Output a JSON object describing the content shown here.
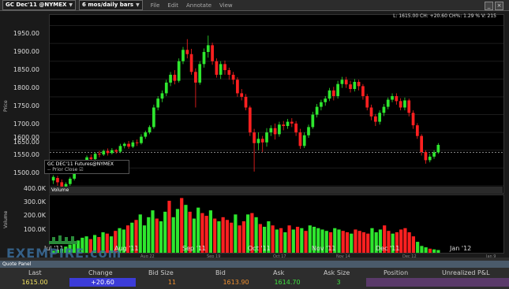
{
  "toolbar": {
    "symbol": "GC Dec'11 @NYMEX",
    "timeframe": "6 mos/daily bars",
    "menus": [
      "File",
      "Edit",
      "Annotate",
      "View"
    ]
  },
  "info_line": "L: 1615.00 CH: +20.60 CH%: 1.29 % V: 215",
  "price_chart": {
    "ylabel": "Price",
    "y_ticks": [
      "1950.00",
      "1900.00",
      "1850.00",
      "1800.00",
      "1750.00",
      "1700.00",
      "1650.00",
      "1600.00",
      "1550.00",
      "1500.00"
    ],
    "contract_label": "GC DEC'11 Futures@NYMEX",
    "prior_close_label": "Prior Close",
    "prior_close_value": 1594.4
  },
  "volume_chart": {
    "header": "Volume",
    "ylabel": "Volume",
    "y_ticks": [
      "400.0K",
      "300.0K",
      "200.0K",
      "100.0K"
    ]
  },
  "x_axis": {
    "months": [
      "Jul '11",
      "Aug '11",
      "Sep '11",
      "Oct '11",
      "Nov '11",
      "Dec '11",
      "Jan '12"
    ],
    "small_dates": [
      "Aug 22",
      "Sep 19",
      "Oct 17",
      "Nov 14",
      "Dec 12",
      "Jan 9"
    ]
  },
  "watermark": "EXEMPIRE.com",
  "quote_panel": {
    "title": "Quote Panel",
    "headers": [
      "Last",
      "Change",
      "Bid Size",
      "Bid",
      "Ask",
      "Ask Size",
      "Position",
      "Unrealized P&L"
    ],
    "values": [
      "1615.00",
      "+20.60",
      "11",
      "1613.90",
      "1614.70",
      "3",
      "",
      ""
    ]
  },
  "colors": {
    "up": "#2ee62e",
    "down": "#ff2020",
    "change_bg": "#3c3cd8",
    "panel_bg": "#2d2d2d"
  },
  "chart_data": [
    {
      "type": "candlestick",
      "ylabel": "Price",
      "ylim": [
        1480,
        1980
      ],
      "points": [
        [
          1515,
          1525,
          1505,
          1530
        ],
        [
          1522,
          1510,
          1500,
          1528
        ],
        [
          1510,
          1498,
          1490,
          1518
        ],
        [
          1498,
          1505,
          1488,
          1510
        ],
        [
          1505,
          1520,
          1500,
          1525
        ],
        [
          1520,
          1540,
          1515,
          1545
        ],
        [
          1540,
          1550,
          1535,
          1555
        ],
        [
          1550,
          1568,
          1545,
          1572
        ],
        [
          1568,
          1580,
          1560,
          1585
        ],
        [
          1580,
          1575,
          1565,
          1588
        ],
        [
          1575,
          1590,
          1570,
          1595
        ],
        [
          1590,
          1588,
          1580,
          1598
        ],
        [
          1588,
          1598,
          1584,
          1602
        ],
        [
          1598,
          1592,
          1585,
          1605
        ],
        [
          1592,
          1600,
          1588,
          1606
        ],
        [
          1600,
          1596,
          1590,
          1604
        ],
        [
          1596,
          1612,
          1592,
          1618
        ],
        [
          1612,
          1618,
          1605,
          1622
        ],
        [
          1618,
          1610,
          1604,
          1626
        ],
        [
          1610,
          1622,
          1606,
          1628
        ],
        [
          1622,
          1620,
          1612,
          1630
        ],
        [
          1620,
          1638,
          1616,
          1645
        ],
        [
          1638,
          1650,
          1632,
          1655
        ],
        [
          1650,
          1665,
          1645,
          1670
        ],
        [
          1665,
          1720,
          1660,
          1728
        ],
        [
          1720,
          1745,
          1712,
          1752
        ],
        [
          1745,
          1760,
          1735,
          1768
        ],
        [
          1760,
          1790,
          1752,
          1798
        ],
        [
          1790,
          1812,
          1780,
          1820
        ],
        [
          1812,
          1795,
          1785,
          1825
        ],
        [
          1795,
          1850,
          1790,
          1858
        ],
        [
          1850,
          1882,
          1842,
          1890
        ],
        [
          1882,
          1870,
          1858,
          1912
        ],
        [
          1870,
          1820,
          1812,
          1885
        ],
        [
          1820,
          1790,
          1720,
          1830
        ],
        [
          1790,
          1842,
          1784,
          1850
        ],
        [
          1842,
          1876,
          1832,
          1886
        ],
        [
          1876,
          1895,
          1860,
          1922
        ],
        [
          1895,
          1850,
          1840,
          1902
        ],
        [
          1850,
          1812,
          1804,
          1858
        ],
        [
          1812,
          1842,
          1800,
          1850
        ],
        [
          1842,
          1825,
          1812,
          1852
        ],
        [
          1825,
          1812,
          1798,
          1832
        ],
        [
          1812,
          1798,
          1785,
          1820
        ],
        [
          1798,
          1760,
          1750,
          1805
        ],
        [
          1760,
          1750,
          1740,
          1772
        ],
        [
          1750,
          1720,
          1712,
          1758
        ],
        [
          1720,
          1650,
          1640,
          1725
        ],
        [
          1650,
          1620,
          1540,
          1660
        ],
        [
          1620,
          1632,
          1600,
          1650
        ],
        [
          1632,
          1622,
          1595,
          1640
        ],
        [
          1622,
          1650,
          1610,
          1662
        ],
        [
          1650,
          1662,
          1640,
          1670
        ],
        [
          1662,
          1645,
          1630,
          1675
        ],
        [
          1645,
          1672,
          1638,
          1680
        ],
        [
          1672,
          1668,
          1656,
          1682
        ],
        [
          1668,
          1680,
          1660,
          1688
        ],
        [
          1680,
          1675,
          1665,
          1690
        ],
        [
          1675,
          1650,
          1640,
          1682
        ],
        [
          1650,
          1612,
          1604,
          1660
        ],
        [
          1612,
          1642,
          1606,
          1650
        ],
        [
          1642,
          1665,
          1635,
          1672
        ],
        [
          1665,
          1700,
          1660,
          1708
        ],
        [
          1700,
          1722,
          1692,
          1730
        ],
        [
          1722,
          1735,
          1712,
          1742
        ],
        [
          1735,
          1745,
          1725,
          1752
        ],
        [
          1745,
          1768,
          1738,
          1775
        ],
        [
          1768,
          1752,
          1740,
          1778
        ],
        [
          1752,
          1786,
          1745,
          1795
        ],
        [
          1786,
          1798,
          1775,
          1806
        ],
        [
          1798,
          1785,
          1775,
          1806
        ],
        [
          1785,
          1772,
          1762,
          1795
        ],
        [
          1772,
          1792,
          1765,
          1800
        ],
        [
          1792,
          1780,
          1768,
          1798
        ],
        [
          1780,
          1752,
          1742,
          1786
        ],
        [
          1752,
          1720,
          1712,
          1758
        ],
        [
          1720,
          1695,
          1684,
          1728
        ],
        [
          1695,
          1680,
          1668,
          1702
        ],
        [
          1680,
          1705,
          1672,
          1712
        ],
        [
          1705,
          1722,
          1696,
          1730
        ],
        [
          1722,
          1742,
          1715,
          1748
        ],
        [
          1742,
          1752,
          1735,
          1760
        ],
        [
          1752,
          1738,
          1728,
          1760
        ],
        [
          1738,
          1720,
          1712,
          1746
        ],
        [
          1720,
          1740,
          1712,
          1748
        ],
        [
          1740,
          1705,
          1695,
          1745
        ],
        [
          1705,
          1670,
          1660,
          1712
        ],
        [
          1670,
          1640,
          1632,
          1676
        ],
        [
          1640,
          1595,
          1585,
          1645
        ],
        [
          1595,
          1572,
          1562,
          1600
        ],
        [
          1572,
          1582,
          1566,
          1590
        ],
        [
          1582,
          1594,
          1576,
          1600
        ],
        [
          1594,
          1615,
          1590,
          1620
        ]
      ]
    },
    {
      "type": "bar",
      "ylabel": "Volume",
      "ylim": [
        0,
        420000
      ],
      "values": [
        15000,
        20000,
        30000,
        45000,
        60000,
        80000,
        90000,
        110000,
        120000,
        100000,
        130000,
        115000,
        150000,
        140000,
        120000,
        160000,
        180000,
        170000,
        200000,
        220000,
        240000,
        280000,
        200000,
        260000,
        310000,
        250000,
        230000,
        300000,
        380000,
        260000,
        320000,
        400000,
        350000,
        300000,
        250000,
        330000,
        290000,
        270000,
        310000,
        250000,
        230000,
        260000,
        240000,
        220000,
        280000,
        200000,
        230000,
        280000,
        290000,
        260000,
        210000,
        190000,
        230000,
        200000,
        170000,
        180000,
        150000,
        200000,
        170000,
        190000,
        180000,
        160000,
        200000,
        190000,
        180000,
        170000,
        160000,
        150000,
        180000,
        170000,
        160000,
        150000,
        140000,
        170000,
        160000,
        150000,
        140000,
        180000,
        150000,
        170000,
        200000,
        160000,
        140000,
        150000,
        170000,
        180000,
        150000,
        120000,
        80000,
        50000,
        40000,
        30000,
        25000,
        20000
      ],
      "colors": [
        "up",
        "up",
        "up",
        "up",
        "up",
        "up",
        "up",
        "up",
        "up",
        "down",
        "up",
        "down",
        "up",
        "down",
        "up",
        "down",
        "up",
        "up",
        "down",
        "up",
        "down",
        "up",
        "up",
        "up",
        "up",
        "down",
        "up",
        "up",
        "down",
        "up",
        "up",
        "down",
        "up",
        "down",
        "up",
        "up",
        "down",
        "down",
        "up",
        "down",
        "up",
        "down",
        "down",
        "down",
        "up",
        "down",
        "down",
        "up",
        "down",
        "up",
        "down",
        "up",
        "up",
        "down",
        "up",
        "down",
        "up",
        "down",
        "up",
        "down",
        "up",
        "down",
        "up",
        "up",
        "up",
        "up",
        "up",
        "down",
        "up",
        "up",
        "down",
        "down",
        "up",
        "down",
        "down",
        "down",
        "down",
        "up",
        "up",
        "up",
        "down",
        "down",
        "up",
        "down",
        "down",
        "down",
        "down",
        "down",
        "up",
        "up",
        "up",
        "down",
        "up",
        "up"
      ]
    }
  ]
}
